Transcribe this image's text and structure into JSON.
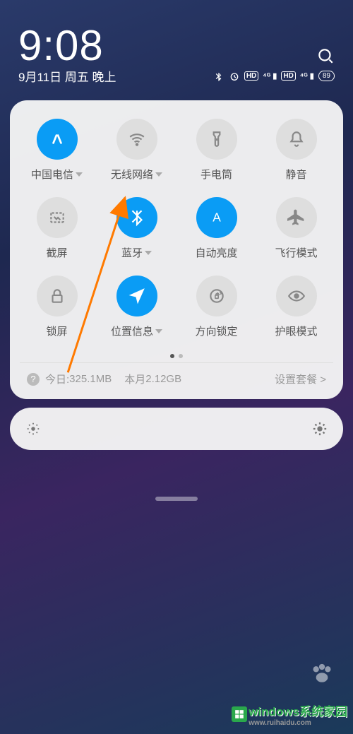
{
  "status": {
    "time": "9:08",
    "date": "9月11日 周五 晚上",
    "battery": "89"
  },
  "tiles": [
    {
      "id": "mobile-data",
      "label": "中国电信",
      "active": true,
      "caret": true
    },
    {
      "id": "wifi",
      "label": "无线网络",
      "active": false,
      "caret": true
    },
    {
      "id": "flashlight",
      "label": "手电筒",
      "active": false
    },
    {
      "id": "mute",
      "label": "静音",
      "active": false
    },
    {
      "id": "screenshot",
      "label": "截屏",
      "active": false
    },
    {
      "id": "bluetooth",
      "label": "蓝牙",
      "active": true,
      "caret": true
    },
    {
      "id": "auto-brightness",
      "label": "自动亮度",
      "active": true
    },
    {
      "id": "airplane",
      "label": "飞行模式",
      "active": false
    },
    {
      "id": "lock",
      "label": "锁屏",
      "active": false
    },
    {
      "id": "location",
      "label": "位置信息",
      "active": true,
      "caret": true
    },
    {
      "id": "rotation-lock",
      "label": "方向锁定",
      "active": false
    },
    {
      "id": "eye-care",
      "label": "护眼模式",
      "active": false
    }
  ],
  "data_usage": {
    "today_label": "今日:",
    "today_value": "325.1MB",
    "month_label": "本月",
    "month_value": "2.12GB",
    "plan_label": "设置套餐 >"
  },
  "watermark": {
    "brand": "windows系统家园",
    "url": "www.ruihaidu.com"
  }
}
